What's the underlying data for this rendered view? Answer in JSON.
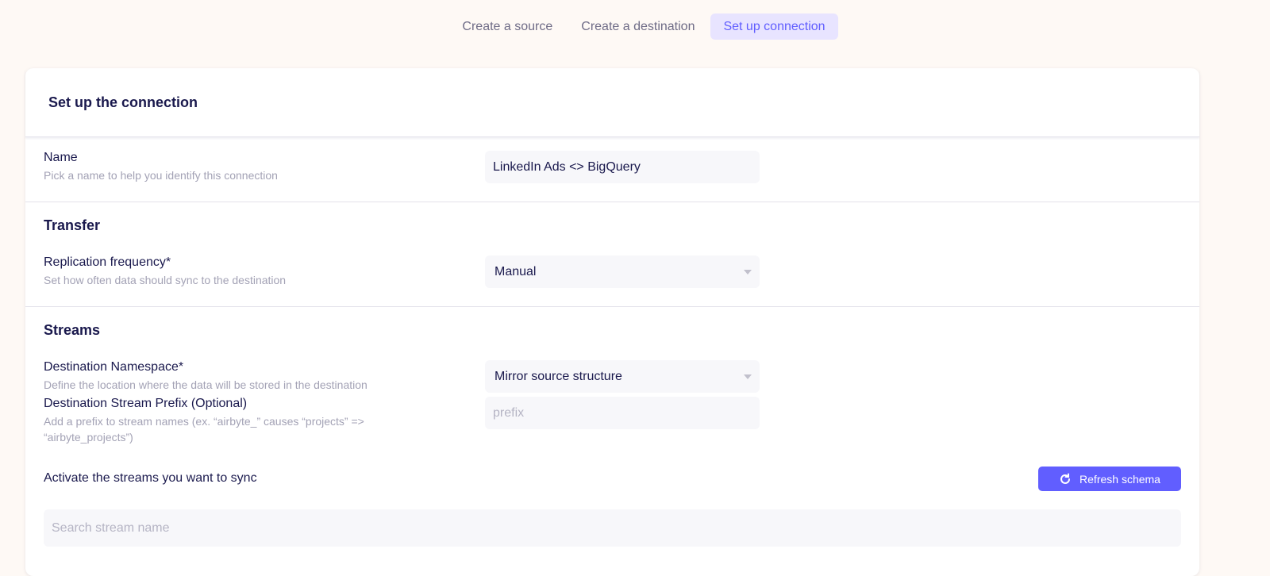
{
  "steps": [
    {
      "label": "Create a source",
      "active": false
    },
    {
      "label": "Create a destination",
      "active": false
    },
    {
      "label": "Set up connection",
      "active": true
    }
  ],
  "card": {
    "title": "Set up the connection"
  },
  "name_field": {
    "label": "Name",
    "hint": "Pick a name to help you identify this connection",
    "value": "LinkedIn Ads <> BigQuery"
  },
  "transfer": {
    "title": "Transfer",
    "replication": {
      "label": "Replication frequency*",
      "hint": "Set how often data should sync to the destination",
      "value": "Manual"
    }
  },
  "streams": {
    "title": "Streams",
    "namespace": {
      "label": "Destination Namespace*",
      "hint": "Define the location where the data will be stored in the destination",
      "value": "Mirror source structure"
    },
    "prefix": {
      "label": "Destination Stream Prefix (Optional)",
      "hint": "Add a prefix to stream names (ex. “airbyte_” causes “projects” => “airbyte_projects”)",
      "placeholder": "prefix"
    },
    "activate_label": "Activate the streams you want to sync",
    "refresh_label": "Refresh schema",
    "search_placeholder": "Search stream name"
  },
  "colors": {
    "accent": "#615eff",
    "background": "#fef9f5",
    "text": "#1a194d",
    "muted": "#a3a2b5"
  },
  "icons": {
    "refresh": "refresh-icon",
    "dropdown": "chevron-down-icon"
  }
}
